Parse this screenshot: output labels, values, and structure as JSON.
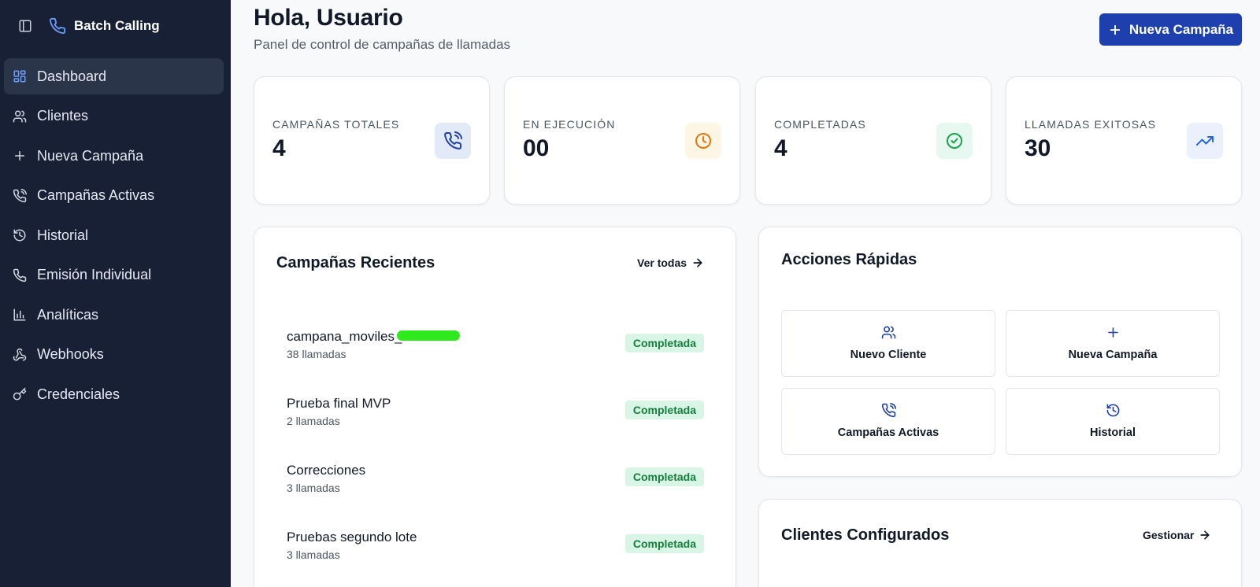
{
  "brand": {
    "name": "Batch Calling",
    "icon": "phone-icon"
  },
  "sidebar": {
    "items": [
      {
        "label": "Dashboard",
        "icon": "layout-grid-icon",
        "active": true
      },
      {
        "label": "Clientes",
        "icon": "users-icon"
      },
      {
        "label": "Nueva Campaña",
        "icon": "plus-icon"
      },
      {
        "label": "Campañas Activas",
        "icon": "phone-outgoing-icon"
      },
      {
        "label": "Historial",
        "icon": "history-icon"
      },
      {
        "label": "Emisión Individual",
        "icon": "phone-icon"
      },
      {
        "label": "Analíticas",
        "icon": "bar-chart-icon"
      },
      {
        "label": "Webhooks",
        "icon": "webhook-icon"
      },
      {
        "label": "Credenciales",
        "icon": "key-icon"
      }
    ]
  },
  "header": {
    "title": "Hola, Usuario",
    "subtitle": "Panel de control de campañas de llamadas",
    "new_button": "Nueva Campaña"
  },
  "stats": [
    {
      "label": "CAMPAÑAS TOTALES",
      "value": "4",
      "icon": "phone-outgoing-icon",
      "bg": "#e3eaf7",
      "color": "#1e40af"
    },
    {
      "label": "EN EJECUCIÓN",
      "value": "00",
      "icon": "clock-icon",
      "bg": "#fef6e4",
      "color": "#e8760a"
    },
    {
      "label": "COMPLETADAS",
      "value": "4",
      "icon": "check-circle-icon",
      "bg": "#e6f8ef",
      "color": "#16a34a"
    },
    {
      "label": "LLAMADAS EXITOSAS",
      "value": "30",
      "icon": "trending-up-icon",
      "bg": "#eaf1fc",
      "color": "#2563eb"
    }
  ],
  "recent": {
    "title": "Campañas Recientes",
    "link": "Ver todas",
    "items": [
      {
        "name": "campana_moviles_",
        "count": "38 llamadas",
        "status": "Completada"
      },
      {
        "name": "Prueba final MVP",
        "count": "2 llamadas",
        "status": "Completada"
      },
      {
        "name": "Correcciones",
        "count": "3 llamadas",
        "status": "Completada"
      },
      {
        "name": "Pruebas segundo lote",
        "count": "3 llamadas",
        "status": "Completada"
      }
    ]
  },
  "quick_actions": {
    "title": "Acciones Rápidas",
    "items": [
      {
        "label": "Nuevo Cliente",
        "icon": "users-icon"
      },
      {
        "label": "Nueva Campaña",
        "icon": "plus-icon"
      },
      {
        "label": "Campañas Activas",
        "icon": "phone-outgoing-icon"
      },
      {
        "label": "Historial",
        "icon": "history-icon"
      }
    ]
  },
  "clients": {
    "title": "Clientes Configurados",
    "link": "Gestionar"
  }
}
